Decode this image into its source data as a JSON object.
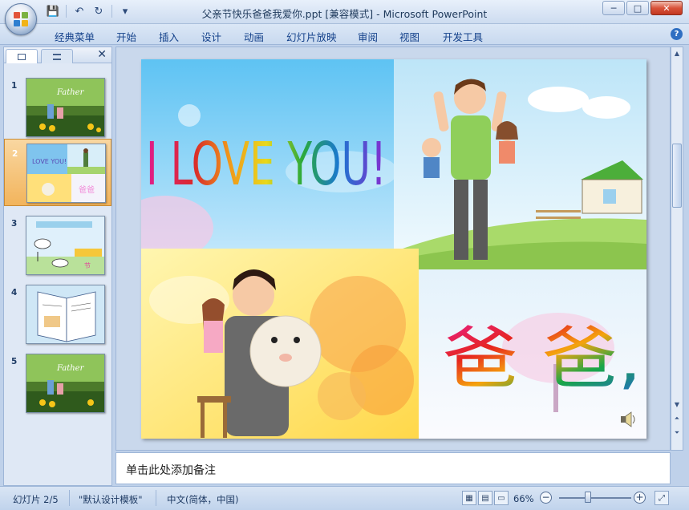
{
  "window": {
    "title": "父亲节快乐爸爸我爱你.ppt [兼容模式] - Microsoft PowerPoint",
    "controls": {
      "minimize": "─",
      "maximize": "□",
      "close": "✕"
    }
  },
  "quick_access": {
    "save": "💾",
    "undo": "↶",
    "redo": "↻",
    "more": "▾"
  },
  "ribbon": {
    "tabs": [
      {
        "label": "经典菜单"
      },
      {
        "label": "开始"
      },
      {
        "label": "插入"
      },
      {
        "label": "设计"
      },
      {
        "label": "动画"
      },
      {
        "label": "幻灯片放映"
      },
      {
        "label": "审阅"
      },
      {
        "label": "视图"
      },
      {
        "label": "开发工具"
      }
    ],
    "help": "?"
  },
  "left_pane": {
    "close": "✕",
    "slides": [
      {
        "num": "1",
        "selected": false
      },
      {
        "num": "2",
        "selected": true
      },
      {
        "num": "3",
        "selected": false
      },
      {
        "num": "4",
        "selected": false
      },
      {
        "num": "5",
        "selected": false
      }
    ]
  },
  "slide": {
    "headline": "I LOVE YOU!",
    "caption": "爸 爸,"
  },
  "notes": {
    "placeholder": "单击此处添加备注"
  },
  "status": {
    "slide_info": "幻灯片 2/5",
    "theme": "\"默认设计模板\"",
    "language": "中文(简体，中国)",
    "zoom": "66%",
    "zoom_level": 0.4
  },
  "colors": {
    "accent": "#15428b",
    "selected_thumb": "#f2b45c"
  }
}
